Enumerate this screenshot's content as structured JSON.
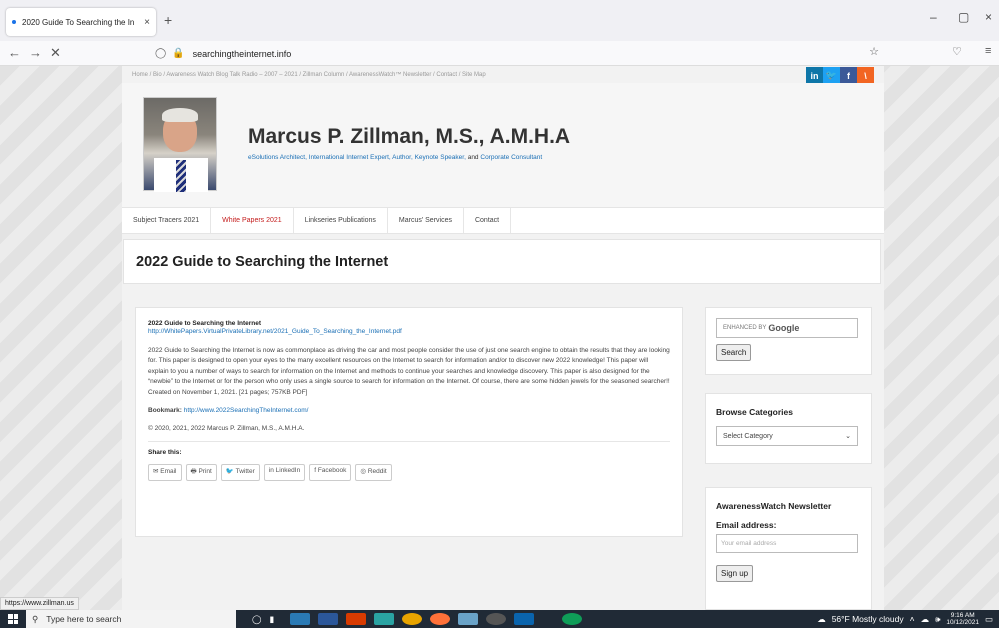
{
  "browser": {
    "tab_title": "2020 Guide To Searching the In",
    "tab_close": "×",
    "new_tab": "+",
    "url": "searchingtheinternet.info",
    "win_min": "–",
    "win_max": "▢",
    "win_close": "×"
  },
  "site": {
    "breadcrumb": "Home  /  Bio  /  Awareness Watch Blog Talk Radio – 2007 – 2021  /  Zillman Column  /  AwarenessWatch™ Newsletter  /  Contact  /  Site Map",
    "social": [
      {
        "label": "in",
        "color": "#0e76a8"
      },
      {
        "label": "🐦",
        "color": "#1da1f2"
      },
      {
        "label": "f",
        "color": "#3b5998"
      },
      {
        "label": "\\",
        "color": "#f26522"
      }
    ],
    "title": "Marcus P. Zillman, M.S., A.M.H.A",
    "tagline_1": "eSolutions Architect, International Internet Expert, Author, Keynote Speaker,",
    "tagline_and": "and",
    "tagline_2": "Corporate Consultant",
    "nav": [
      {
        "label": "Subject Tracers 2021",
        "active": false
      },
      {
        "label": "White Papers 2021",
        "active": true
      },
      {
        "label": "Linkseries Publications",
        "active": false
      },
      {
        "label": "Marcus' Services",
        "active": false
      },
      {
        "label": "Contact",
        "active": false
      }
    ],
    "page_title": "2022 Guide to Searching the Internet"
  },
  "post": {
    "heading": "2022 Guide to Searching the Internet",
    "pdf_link": "http://WhitePapers.VirtualPrivateLibrary.net/2021_Guide_To_Searching_the_Internet.pdf",
    "body": "2022 Guide to Searching the Internet is now as commonplace as driving the car and most people consider the use of just one search engine to obtain the results that they are looking for. This paper is designed to open your eyes to the many excellent resources on the Internet to search for information and/or to discover new 2022 knowledge! This paper will explain to you a number of ways to search for information on the Internet and methods to continue your searches and knowledge discovery. This paper is also designed for the “newbie” to the Internet or for the person who only uses a single source to search for information on the Internet. Of course, there are some hidden jewels for the seasoned searcher!! Created on November 1, 2021. [21 pages; 757KB PDF]",
    "bookmark_label": "Bookmark:",
    "bookmark_link": "http://www.2022SearchingTheInternet.com/",
    "copyright": "© 2020, 2021, 2022 Marcus P. Zillman, M.S., A.M.H.A.",
    "share_label": "Share this:",
    "share_buttons": [
      "✉ Email",
      "🖶 Print",
      "🐦 Twitter",
      "in LinkedIn",
      "f Facebook",
      "◎ Reddit"
    ]
  },
  "sidebar": {
    "search_placeholder": "ENHANCED BY",
    "search_google": "Google",
    "search_button": "Search",
    "browse_title": "Browse Categories",
    "category_select": "Select Category",
    "newsletter_title": "AwarenessWatch Newsletter",
    "email_label": "Email address:",
    "email_placeholder": "Your email address",
    "signup_button": "Sign up"
  },
  "status_url": "https://www.zillman.us",
  "taskbar": {
    "search_placeholder": "Type here to search",
    "weather": "56°F  Mostly cloudy",
    "time": "9:16 AM",
    "date": "10/12/2021"
  }
}
